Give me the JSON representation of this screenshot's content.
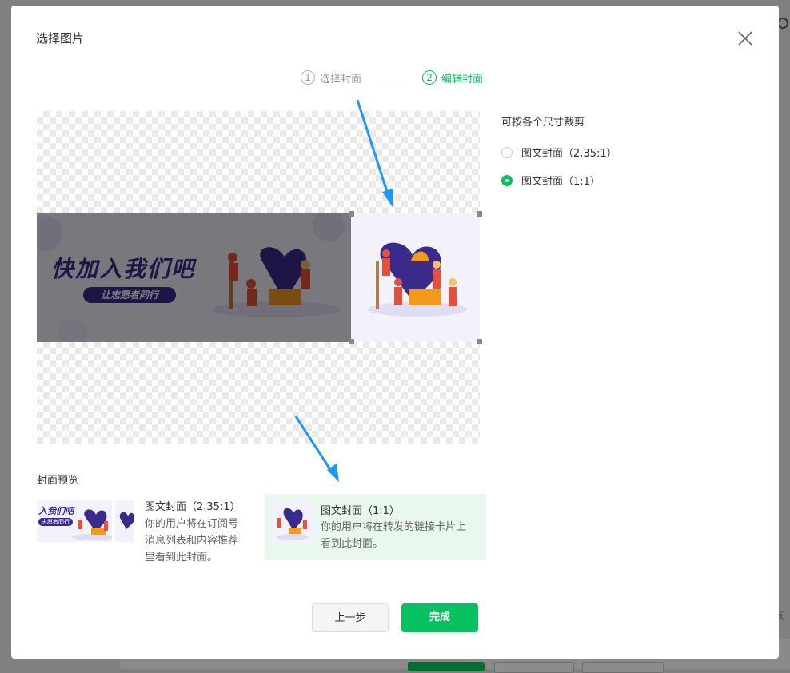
{
  "dialog": {
    "title": "选择图片"
  },
  "steps": [
    {
      "num": "1",
      "label": "选择封面",
      "active": false
    },
    {
      "num": "2",
      "label": "编辑封面",
      "active": true
    }
  ],
  "banner": {
    "headline": "快加入我们吧",
    "tagline": "让志愿者同行",
    "thumb_headline": "入我们吧",
    "thumb_tagline": "志愿者同行"
  },
  "crop_options": {
    "title": "可按各个尺寸裁剪",
    "options": [
      {
        "label": "图文封面（2.35:1）",
        "checked": false
      },
      {
        "label": "图文封面（1:1）",
        "checked": true
      }
    ]
  },
  "preview": {
    "title": "封面预览",
    "cards": [
      {
        "title": "图文封面（2.35:1）",
        "desc_lines": [
          "你的用户将在订阅号",
          "消息列表和内容推荐",
          "里看到此封面。"
        ]
      },
      {
        "title": "图文封面（1:1）",
        "desc_lines": [
          "你的用户将在转发的链接卡片上",
          "看到此封面。"
        ]
      }
    ]
  },
  "buttons": {
    "prev": "上一步",
    "done": "完成"
  },
  "colors": {
    "accent": "#07c160",
    "arrow": "#2196f3",
    "banner_purple": "#3a2a8a"
  },
  "background": {
    "right_text": "间"
  }
}
